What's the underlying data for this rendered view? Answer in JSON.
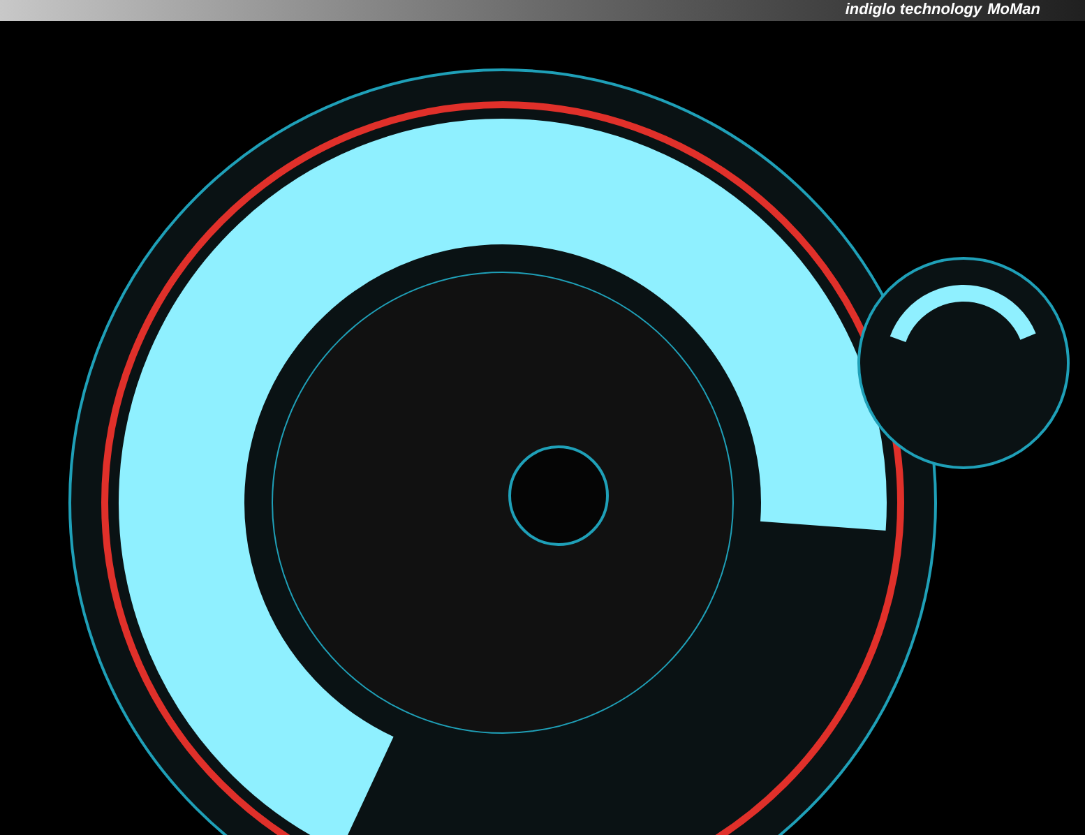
{
  "banner": {
    "text": "indiglo technology",
    "brand": "MoMan"
  }
}
